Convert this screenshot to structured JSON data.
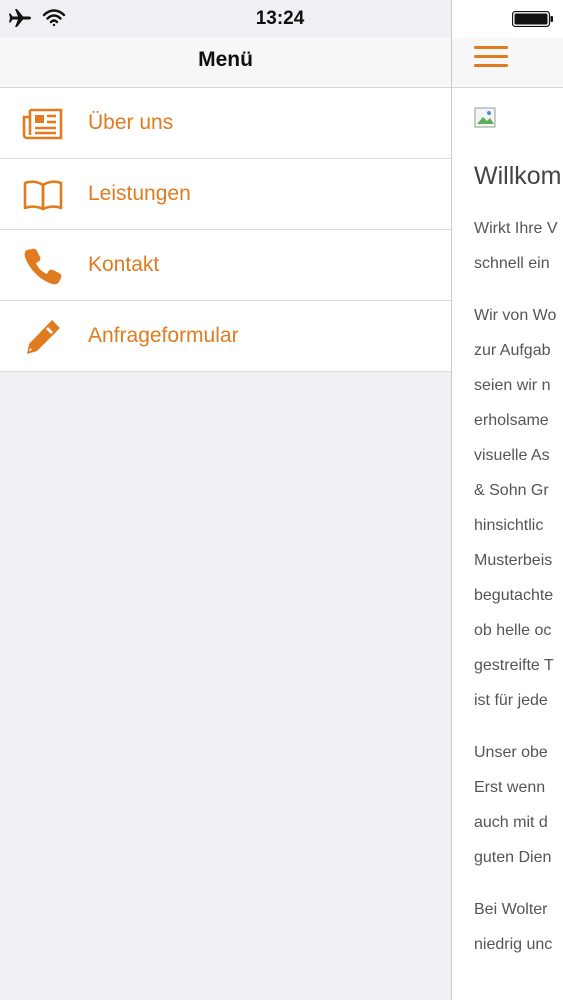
{
  "status_bar": {
    "time": "13:24",
    "airplane_icon": "airplane-icon",
    "wifi_icon": "wifi-icon",
    "battery_icon": "battery-icon"
  },
  "menu": {
    "title": "Menü",
    "items": [
      {
        "label": "Über uns",
        "icon": "newspaper-icon"
      },
      {
        "label": "Leistungen",
        "icon": "book-open-icon"
      },
      {
        "label": "Kontakt",
        "icon": "phone-icon"
      },
      {
        "label": "Anfrageformular",
        "icon": "pencil-icon"
      }
    ]
  },
  "content": {
    "menu_icon": "hamburger-icon",
    "title": "Willkom",
    "paragraphs": [
      [
        "Wirkt Ihre V",
        "schnell ein"
      ],
      [
        "Wir von Wo",
        "zur Aufgab",
        "seien wir n",
        "erholsame",
        "visuelle As",
        "& Sohn Gr",
        "hinsichtlic",
        "Musterbeis",
        "begutachte",
        "ob helle oc",
        "gestreifte T",
        "ist für jede"
      ],
      [
        "Unser obe",
        "Erst wenn",
        "auch mit d",
        "guten Dien"
      ],
      [
        "Bei Wolter",
        "niedrig unc"
      ]
    ]
  },
  "colors": {
    "accent": "#e07b1f",
    "panel_bg": "#efeff4"
  }
}
